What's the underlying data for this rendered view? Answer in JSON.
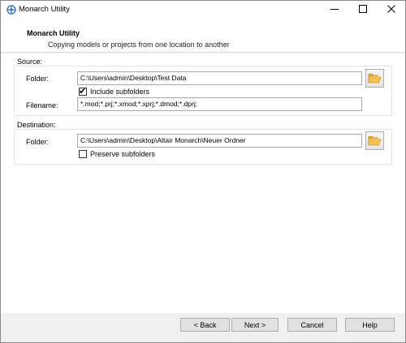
{
  "window": {
    "title": "Monarch Utility",
    "icons": {
      "app": "monarch-app-icon",
      "minimize": "minimize-icon",
      "maximize": "maximize-icon",
      "close": "close-icon"
    }
  },
  "header": {
    "title": "Monarch Utility",
    "subtitle": "Copying models or projects from one location to another"
  },
  "source": {
    "group_label": "Source:",
    "folder_label": "Folder:",
    "folder_value": "C:\\Users\\admin\\Desktop\\Test Data",
    "include_subfolders_label": "Include subfolders",
    "include_subfolders_checked": true,
    "filename_label": "Filename:",
    "filename_value": "*.mod;*.prj;*.xmod;*.xprj;*.dmod;*.dprj;"
  },
  "destination": {
    "group_label": "Destination:",
    "folder_label": "Folder:",
    "folder_value": "C:\\Users\\admin\\Desktop\\Altair Monarch\\Neuer Ordner",
    "preserve_subfolders_label": "Preserve subfolders",
    "preserve_subfolders_checked": false
  },
  "footer": {
    "back_label": "< Back",
    "next_label": "Next >",
    "cancel_label": "Cancel",
    "help_label": "Help"
  },
  "colors": {
    "folder_icon": "#f2c14e",
    "folder_icon_dark": "#d9a12a",
    "app_icon": "#3a78c2"
  }
}
